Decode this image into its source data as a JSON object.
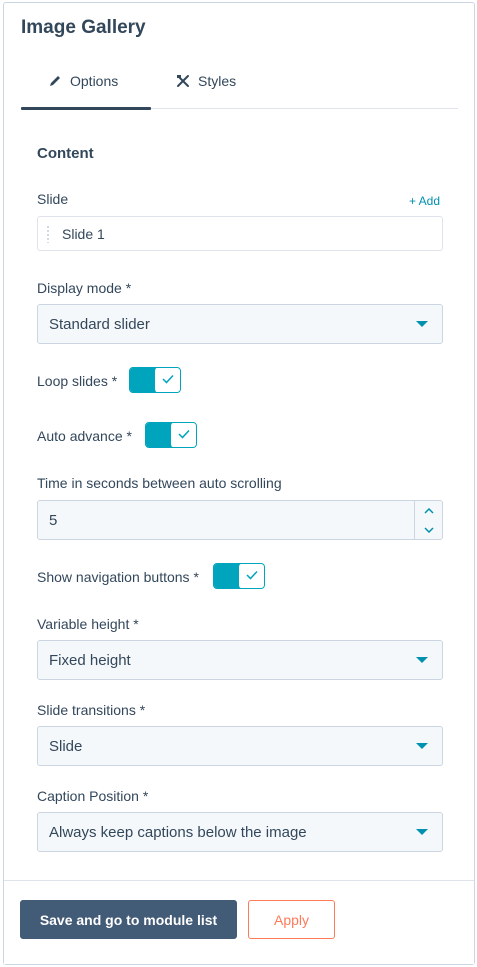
{
  "panel": {
    "title": "Image Gallery"
  },
  "tabs": [
    {
      "label": "Options",
      "icon": "pencil-icon",
      "active": true
    },
    {
      "label": "Styles",
      "icon": "styles-icon",
      "active": false
    }
  ],
  "content": {
    "section_title": "Content",
    "slide": {
      "label": "Slide",
      "add_label": "+ Add",
      "items": [
        "Slide 1"
      ]
    },
    "display_mode": {
      "label": "Display mode *",
      "value": "Standard slider"
    },
    "loop_slides": {
      "label": "Loop slides *",
      "checked": true
    },
    "auto_advance": {
      "label": "Auto advance *",
      "checked": true
    },
    "time_seconds": {
      "label": "Time in seconds between auto scrolling",
      "value": "5"
    },
    "show_nav_buttons": {
      "label": "Show navigation buttons *",
      "checked": true
    },
    "variable_height": {
      "label": "Variable height *",
      "value": "Fixed height"
    },
    "slide_transitions": {
      "label": "Slide transitions *",
      "value": "Slide"
    },
    "caption_position": {
      "label": "Caption Position *",
      "value": "Always keep captions below the image"
    }
  },
  "footer": {
    "primary_label": "Save and go to module list",
    "secondary_label": "Apply"
  },
  "colors": {
    "accent": "#00a4bd",
    "link": "#0091ae",
    "primary_button": "#425b76",
    "apply_button": "#ff7a59",
    "text": "#33475b"
  }
}
